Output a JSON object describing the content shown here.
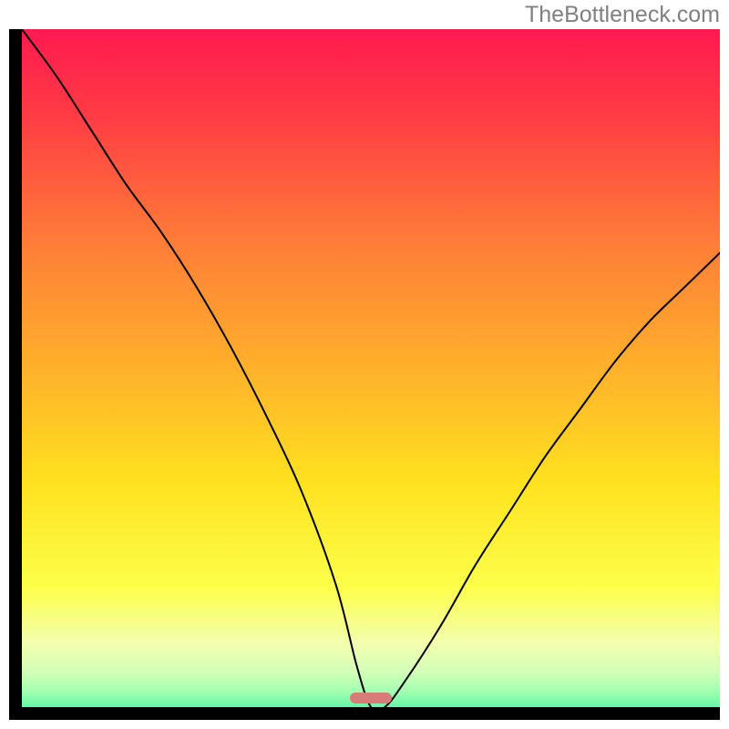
{
  "watermark": "TheBottleneck.com",
  "chart_data": {
    "type": "line",
    "title": "",
    "xlabel": "",
    "ylabel": "",
    "xlim": [
      0,
      100
    ],
    "ylim": [
      0,
      100
    ],
    "grid": false,
    "legend": false,
    "background_gradient": {
      "stops": [
        {
          "pct": 0,
          "color": "#ff1a50"
        },
        {
          "pct": 12,
          "color": "#ff3a45"
        },
        {
          "pct": 30,
          "color": "#ff7b38"
        },
        {
          "pct": 50,
          "color": "#ffb52a"
        },
        {
          "pct": 65,
          "color": "#ffe21f"
        },
        {
          "pct": 80,
          "color": "#fdff4a"
        },
        {
          "pct": 88,
          "color": "#f3ffb0"
        },
        {
          "pct": 92,
          "color": "#d4ffb8"
        },
        {
          "pct": 95,
          "color": "#9fffb0"
        },
        {
          "pct": 98,
          "color": "#4cf5a0"
        },
        {
          "pct": 100,
          "color": "#17e39a"
        }
      ]
    },
    "series": [
      {
        "name": "bottleneck-curve",
        "color": "#000000",
        "x": [
          0,
          5,
          10,
          15,
          20,
          25,
          30,
          35,
          40,
          45,
          48,
          50,
          52,
          55,
          60,
          65,
          70,
          75,
          80,
          85,
          90,
          95,
          100
        ],
        "y": [
          100,
          93,
          85,
          77,
          70,
          62,
          53,
          43,
          32,
          18,
          6,
          0,
          0,
          4,
          12,
          21,
          29,
          37,
          44,
          51,
          57,
          62,
          67
        ]
      }
    ],
    "marker": {
      "name": "target-range",
      "x_center": 50,
      "width_pct": 6,
      "color": "#d77c78"
    }
  }
}
